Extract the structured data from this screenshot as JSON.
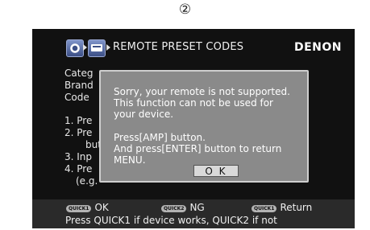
{
  "step_marker": "②",
  "header": {
    "title": "REMOTE PRESET CODES",
    "brand": "DENON"
  },
  "content": {
    "category": "Categ",
    "brand": "Brand",
    "code": "Code",
    "step1": "1. Pre",
    "step2": "2. Pre",
    "step2b": "but",
    "step3": "3. Inp",
    "step4": "4. Pre",
    "example": "(e.g."
  },
  "dialog": {
    "line1": "Sorry, your remote is not supported.",
    "line2": "This function can not be used for",
    "line3": "your device.",
    "line4": "Press[AMP] button.",
    "line5": "And press[ENTER] button to return",
    "line6": "MENU.",
    "ok_label": "O K"
  },
  "footer": {
    "quick1_badge": "QUICK1",
    "quick1_label": "OK",
    "quick2_badge": "QUICK2",
    "quick2_label": "NG",
    "quick1b_badge": "QUICK1",
    "quick1b_label": "Return",
    "hint": "Press QUICK1 if device works, QUICK2 if not"
  }
}
